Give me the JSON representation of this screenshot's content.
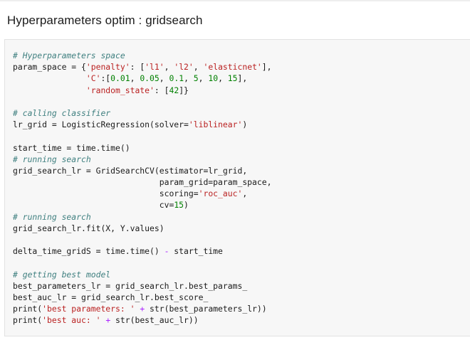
{
  "page": {
    "heading": "Hyperparameters optim : gridsearch"
  },
  "code": {
    "lines": [
      [
        {
          "t": "# Hyperparameters space",
          "c": "cm"
        }
      ],
      [
        {
          "t": "param_space = {",
          "c": ""
        },
        {
          "t": "'penalty'",
          "c": "st"
        },
        {
          "t": ": [",
          "c": ""
        },
        {
          "t": "'l1'",
          "c": "st"
        },
        {
          "t": ", ",
          "c": ""
        },
        {
          "t": "'l2'",
          "c": "st"
        },
        {
          "t": ", ",
          "c": ""
        },
        {
          "t": "'elasticnet'",
          "c": "st"
        },
        {
          "t": "],",
          "c": ""
        }
      ],
      [
        {
          "t": "               ",
          "c": ""
        },
        {
          "t": "'C'",
          "c": "st"
        },
        {
          "t": ":[",
          "c": ""
        },
        {
          "t": "0.01",
          "c": "nm"
        },
        {
          "t": ", ",
          "c": ""
        },
        {
          "t": "0.05",
          "c": "nm"
        },
        {
          "t": ", ",
          "c": ""
        },
        {
          "t": "0.1",
          "c": "nm"
        },
        {
          "t": ", ",
          "c": ""
        },
        {
          "t": "5",
          "c": "nm"
        },
        {
          "t": ", ",
          "c": ""
        },
        {
          "t": "10",
          "c": "nm"
        },
        {
          "t": ", ",
          "c": ""
        },
        {
          "t": "15",
          "c": "nm"
        },
        {
          "t": "],",
          "c": ""
        }
      ],
      [
        {
          "t": "               ",
          "c": ""
        },
        {
          "t": "'random_state'",
          "c": "st"
        },
        {
          "t": ": [",
          "c": ""
        },
        {
          "t": "42",
          "c": "nm"
        },
        {
          "t": "]}",
          "c": ""
        }
      ],
      [
        {
          "t": "",
          "c": ""
        }
      ],
      [
        {
          "t": "# calling classifier",
          "c": "cm"
        }
      ],
      [
        {
          "t": "lr_grid = LogisticRegression(solver=",
          "c": ""
        },
        {
          "t": "'liblinear'",
          "c": "st"
        },
        {
          "t": ")",
          "c": ""
        }
      ],
      [
        {
          "t": "",
          "c": ""
        }
      ],
      [
        {
          "t": "start_time = time.time()",
          "c": ""
        }
      ],
      [
        {
          "t": "# running search",
          "c": "cm"
        }
      ],
      [
        {
          "t": "grid_search_lr = GridSearchCV(estimator=lr_grid,",
          "c": ""
        }
      ],
      [
        {
          "t": "                              param_grid=param_space,",
          "c": ""
        }
      ],
      [
        {
          "t": "                              scoring=",
          "c": ""
        },
        {
          "t": "'roc_auc'",
          "c": "st"
        },
        {
          "t": ",",
          "c": ""
        }
      ],
      [
        {
          "t": "                              cv=",
          "c": ""
        },
        {
          "t": "15",
          "c": "nm"
        },
        {
          "t": ")",
          "c": ""
        }
      ],
      [
        {
          "t": "# running search",
          "c": "cm"
        }
      ],
      [
        {
          "t": "grid_search_lr.fit(X, Y.values)",
          "c": ""
        }
      ],
      [
        {
          "t": "",
          "c": ""
        }
      ],
      [
        {
          "t": "delta_time_gridS = time.time() ",
          "c": ""
        },
        {
          "t": "-",
          "c": "op"
        },
        {
          "t": " start_time",
          "c": ""
        }
      ],
      [
        {
          "t": "",
          "c": ""
        }
      ],
      [
        {
          "t": "# getting best model",
          "c": "cm"
        }
      ],
      [
        {
          "t": "best_parameters_lr = grid_search_lr.best_params_",
          "c": ""
        }
      ],
      [
        {
          "t": "best_auc_lr = grid_search_lr.best_score_",
          "c": ""
        }
      ],
      [
        {
          "t": "print(",
          "c": ""
        },
        {
          "t": "'best parameters: '",
          "c": "st"
        },
        {
          "t": " ",
          "c": ""
        },
        {
          "t": "+",
          "c": "op"
        },
        {
          "t": " str(best_parameters_lr))",
          "c": ""
        }
      ],
      [
        {
          "t": "print(",
          "c": ""
        },
        {
          "t": "'best auc: '",
          "c": "st"
        },
        {
          "t": " ",
          "c": ""
        },
        {
          "t": "+",
          "c": "op"
        },
        {
          "t": " str(best_auc_lr))",
          "c": ""
        }
      ]
    ]
  }
}
